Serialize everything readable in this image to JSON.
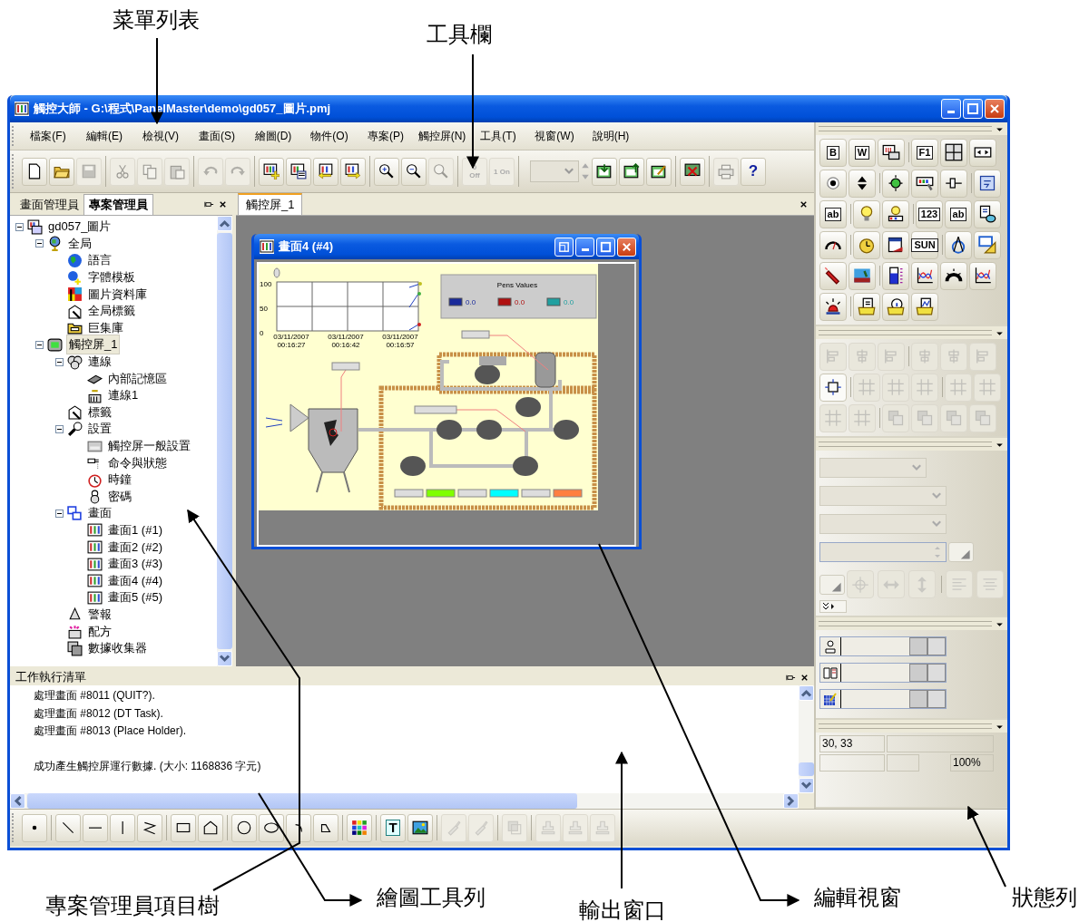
{
  "callouts": [
    "菜單列表",
    "工具欄",
    "專案管理員項目樹",
    "繪圖工具列",
    "輸出窗口",
    "編輯視窗",
    "狀態列"
  ],
  "window": {
    "title": "觸控大師 - G:\\程式\\PanelMaster\\demo\\gd057_圖片.pmj"
  },
  "menu": [
    "檔案(F)",
    "編輯(E)",
    "檢視(V)",
    "畫面(S)",
    "繪圖(D)",
    "物件(O)",
    "專案(P)",
    "觸控屏(N)",
    "工具(T)",
    "視窗(W)",
    "說明(H)"
  ],
  "toolbar": {
    "buttons": [
      {
        "disabled": false
      },
      {
        "disabled": false
      },
      {
        "disabled": true
      },
      {
        "disabled": true
      },
      {
        "disabled": true
      },
      {
        "disabled": true
      },
      {
        "disabled": true
      },
      {
        "disabled": true
      },
      {
        "disabled": false
      },
      {
        "disabled": false
      },
      {
        "disabled": false
      },
      {
        "disabled": false
      },
      {
        "disabled": false
      },
      {
        "disabled": false
      },
      {
        "disabled": true
      },
      {
        "disabled": true,
        "label": "0 Off"
      },
      {
        "disabled": true,
        "label": "1 On"
      },
      {
        "disabled": false
      },
      {
        "disabled": false
      },
      {
        "disabled": false
      },
      {
        "disabled": false
      },
      {
        "disabled": true
      },
      {
        "disabled": false,
        "label": "?"
      }
    ],
    "combo": {
      "disabled": true
    }
  },
  "side_tabs": [
    {
      "label": "畫面管理員",
      "selected": false
    },
    {
      "label": "專案管理員",
      "selected": true
    }
  ],
  "tree": [
    {
      "label": "gd057_圖片",
      "kind": "project",
      "expanded": true,
      "selected": false,
      "children": [
        {
          "label": "全局",
          "kind": "globe",
          "expanded": true,
          "selected": false,
          "children": [
            {
              "label": "語言",
              "kind": "earth",
              "selected": false
            },
            {
              "label": "字體模板",
              "kind": "font",
              "selected": false
            },
            {
              "label": "圖片資料庫",
              "kind": "pictures",
              "selected": false
            },
            {
              "label": "全局標籤",
              "kind": "tags",
              "selected": false
            },
            {
              "label": "巨集庫",
              "kind": "macros",
              "selected": false
            }
          ]
        },
        {
          "label": "觸控屏_1",
          "kind": "panel",
          "expanded": true,
          "selected": true,
          "children": [
            {
              "label": "連線",
              "kind": "links",
              "expanded": true,
              "selected": false,
              "children": [
                {
                  "label": "內部記憶區",
                  "kind": "chip",
                  "selected": false
                },
                {
                  "label": "連線1",
                  "kind": "device",
                  "selected": false
                }
              ]
            },
            {
              "label": "標籤",
              "kind": "tags",
              "selected": false
            },
            {
              "label": "設置",
              "kind": "wrench",
              "expanded": true,
              "selected": false,
              "children": [
                {
                  "label": "觸控屏一般設置",
                  "kind": "form",
                  "selected": false
                },
                {
                  "label": "命令與狀態",
                  "kind": "plug",
                  "selected": false
                },
                {
                  "label": "時鐘",
                  "kind": "clock",
                  "selected": false
                },
                {
                  "label": "密碼",
                  "kind": "lock",
                  "selected": false
                }
              ]
            },
            {
              "label": "畫面",
              "kind": "screens",
              "expanded": true,
              "selected": false,
              "children": [
                {
                  "label": "畫面1 (#1)",
                  "kind": "screen",
                  "selected": false
                },
                {
                  "label": "畫面2 (#2)",
                  "kind": "screen",
                  "selected": false
                },
                {
                  "label": "畫面3 (#3)",
                  "kind": "screen",
                  "selected": false
                },
                {
                  "label": "畫面4 (#4)",
                  "kind": "screen",
                  "selected": false
                },
                {
                  "label": "畫面5 (#5)",
                  "kind": "screen",
                  "selected": false
                }
              ]
            },
            {
              "label": "警報",
              "kind": "alarm",
              "selected": false
            },
            {
              "label": "配方",
              "kind": "recipe",
              "selected": false
            },
            {
              "label": "數據收集器",
              "kind": "logger",
              "selected": false
            }
          ]
        }
      ]
    }
  ],
  "editor": {
    "tab": "觸控屏_1",
    "screen_window": {
      "title": "畫面4 (#4)",
      "trend": {
        "y_labels": [
          "100",
          "50",
          "0"
        ],
        "x_labels": [
          {
            "date": "03/11/2007",
            "time": "00:16:27"
          },
          {
            "date": "03/11/2007",
            "time": "00:16:42"
          },
          {
            "date": "03/11/2007",
            "time": "00:16:57"
          }
        ]
      },
      "pens_title": "Pens Values",
      "pens": [
        {
          "value": "0.0",
          "color": "#1a2a9a"
        },
        {
          "value": "0.0",
          "color": "#b01010"
        },
        {
          "value": "0.0",
          "color": "#20a0a0"
        }
      ]
    }
  },
  "output": {
    "title": "工作執行清單",
    "lines": [
      "處理畫面 #8011 (QUIT?).",
      "處理畫面 #8012 (DT Task).",
      "處理畫面 #8013 (Place Holder)."
    ],
    "result": "成功產生觸控屏運行數據. (大小: 1168836 字元)"
  },
  "draw_toolbar": {
    "buttons": [
      {
        "disabled": false
      },
      {
        "disabled": false
      },
      {
        "disabled": false
      },
      {
        "disabled": false
      },
      {
        "disabled": false
      },
      {
        "disabled": false
      },
      {
        "disabled": false
      },
      {
        "disabled": false
      },
      {
        "disabled": false
      },
      {
        "disabled": false
      },
      {
        "disabled": false
      },
      {
        "disabled": false
      },
      {
        "disabled": false,
        "label": "T"
      },
      {
        "disabled": false
      },
      {
        "disabled": true
      },
      {
        "disabled": true
      },
      {
        "disabled": true
      },
      {
        "disabled": true
      },
      {
        "disabled": true
      },
      {
        "disabled": true
      }
    ]
  },
  "palette": {
    "buttons": [
      {
        "disabled": false,
        "label": "B"
      },
      {
        "disabled": false,
        "label": "W"
      },
      {
        "disabled": false
      },
      {
        "disabled": false,
        "label": "F1"
      },
      {
        "disabled": false
      },
      {
        "disabled": false
      },
      {
        "disabled": false
      },
      {
        "disabled": false
      },
      {
        "disabled": false
      },
      {
        "disabled": false
      },
      {
        "disabled": false
      },
      {
        "disabled": false
      },
      {
        "disabled": false,
        "label": "ab"
      },
      {
        "disabled": false
      },
      {
        "disabled": false
      },
      {
        "disabled": false,
        "label": "123"
      },
      {
        "disabled": false,
        "label": "ab"
      },
      {
        "disabled": false
      },
      {
        "disabled": false
      },
      {
        "disabled": false
      },
      {
        "disabled": false
      },
      {
        "disabled": false,
        "label": "SUN"
      },
      {
        "disabled": false
      },
      {
        "disabled": false
      },
      {
        "disabled": false
      },
      {
        "disabled": false
      },
      {
        "disabled": false
      },
      {
        "disabled": false
      },
      {
        "disabled": false
      },
      {
        "disabled": false
      },
      {
        "disabled": false
      },
      {
        "disabled": false
      },
      {
        "disabled": false
      },
      {
        "disabled": false
      }
    ]
  },
  "align_toolbar": {
    "buttons": [
      {
        "disabled": true
      },
      {
        "disabled": true
      },
      {
        "disabled": true
      },
      {
        "disabled": true
      },
      {
        "disabled": true
      },
      {
        "disabled": true
      },
      {
        "disabled": false
      },
      {
        "disabled": true
      },
      {
        "disabled": true
      },
      {
        "disabled": true
      },
      {
        "disabled": true
      },
      {
        "disabled": true
      },
      {
        "disabled": true
      },
      {
        "disabled": true
      },
      {
        "disabled": true
      },
      {
        "disabled": true
      },
      {
        "disabled": true
      },
      {
        "disabled": true
      }
    ]
  },
  "properties": {
    "disabled": true
  },
  "status": {
    "position": "30, 33",
    "zoom": "100%"
  }
}
